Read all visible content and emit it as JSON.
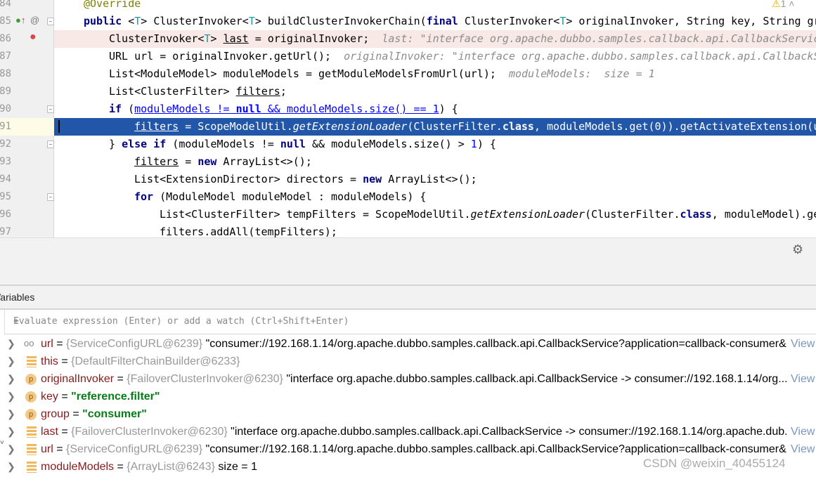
{
  "editor": {
    "warning_count": "1",
    "lines": [
      {
        "n": "84",
        "indent": 0,
        "tokens": [
          [
            "@Override",
            "ann"
          ]
        ]
      },
      {
        "n": "85",
        "indent": 0,
        "tokens": [
          [
            "public",
            "kw"
          ],
          [
            " <",
            ""
          ],
          [
            "T",
            "tp"
          ],
          [
            "> ClusterInvoker<",
            ""
          ],
          [
            "T",
            "tp"
          ],
          [
            "> buildClusterInvokerChain(",
            ""
          ],
          [
            "final",
            "kw"
          ],
          [
            " ClusterInvoker<",
            ""
          ],
          [
            "T",
            "tp"
          ],
          [
            "> originalInvoker, String key, String gr",
            ""
          ]
        ]
      },
      {
        "n": "86",
        "indent": 1,
        "state": "breakpoint",
        "tokens": [
          [
            "ClusterInvoker<",
            ""
          ],
          [
            "T",
            "tp"
          ],
          [
            "> ",
            ""
          ],
          [
            "last",
            "ul"
          ],
          [
            " = originalInvoker;  ",
            ""
          ],
          [
            "last: \"interface org.apache.dubbo.samples.callback.api.CallbackServic",
            "hint"
          ]
        ]
      },
      {
        "n": "87",
        "indent": 1,
        "tokens": [
          [
            "URL url = originalInvoker.getUrl();  ",
            ""
          ],
          [
            "originalInvoker: \"interface org.apache.dubbo.samples.callback.api.CallbackS",
            "hint"
          ]
        ]
      },
      {
        "n": "88",
        "indent": 1,
        "tokens": [
          [
            "List<ModuleModel> moduleModels = getModuleModelsFromUrl(url);  ",
            ""
          ],
          [
            "moduleModels:  size = 1",
            "hint"
          ]
        ]
      },
      {
        "n": "89",
        "indent": 1,
        "tokens": [
          [
            "List<ClusterFilter> ",
            ""
          ],
          [
            "filters",
            "ul"
          ],
          [
            ";",
            ""
          ]
        ]
      },
      {
        "n": "90",
        "indent": 1,
        "tokens": [
          [
            "if",
            "kw"
          ],
          [
            " (",
            ""
          ],
          [
            "moduleModels != ",
            "link"
          ],
          [
            "null",
            "link kw"
          ],
          [
            " && moduleModels.size() == ",
            "link"
          ],
          [
            "1",
            "link"
          ],
          [
            ") {",
            ""
          ]
        ]
      },
      {
        "n": "91",
        "indent": 2,
        "state": "current",
        "tokens": [
          [
            "filters",
            "ul"
          ],
          [
            " = ScopeModelUtil.",
            ""
          ],
          [
            "getExtensionLoader",
            "it"
          ],
          [
            "(ClusterFilter.",
            ""
          ],
          [
            "class",
            "kw"
          ],
          [
            ", moduleModels.get(0)).getActivateExtension(u",
            ""
          ]
        ]
      },
      {
        "n": "92",
        "indent": 1,
        "tokens": [
          [
            "} ",
            ""
          ],
          [
            "else if",
            "kw"
          ],
          [
            " (moduleModels != ",
            ""
          ],
          [
            "null",
            "kw"
          ],
          [
            " && moduleModels.size() > ",
            ""
          ],
          [
            "1",
            "num"
          ],
          [
            ") {",
            ""
          ]
        ]
      },
      {
        "n": "93",
        "indent": 2,
        "tokens": [
          [
            "filters",
            "ul"
          ],
          [
            " = ",
            ""
          ],
          [
            "new",
            "kw"
          ],
          [
            " ArrayList<>();",
            ""
          ]
        ]
      },
      {
        "n": "94",
        "indent": 2,
        "tokens": [
          [
            "List<ExtensionDirector> directors = ",
            ""
          ],
          [
            "new",
            "kw"
          ],
          [
            " ArrayList<>();",
            ""
          ]
        ]
      },
      {
        "n": "95",
        "indent": 2,
        "tokens": [
          [
            "for",
            "kw"
          ],
          [
            " (ModuleModel moduleModel : moduleModels) {",
            ""
          ]
        ]
      },
      {
        "n": "96",
        "indent": 3,
        "tokens": [
          [
            "List<ClusterFilter> tempFilters = ScopeModelUtil.",
            ""
          ],
          [
            "getExtensionLoader",
            "it"
          ],
          [
            "(ClusterFilter.",
            ""
          ],
          [
            "class",
            "kw"
          ],
          [
            ", moduleModel).ge",
            ""
          ]
        ]
      },
      {
        "n": "97",
        "indent": 3,
        "tokens": [
          [
            "filters.addAll(tempFilters);",
            ""
          ]
        ]
      }
    ]
  },
  "variables": {
    "tab_label": "Variables",
    "eval_placeholder": "Evaluate expression (Enter) or add a watch (Ctrl+Shift+Enter)",
    "view_label": "View",
    "rows": [
      {
        "icon": "watch",
        "name": "url",
        "type": "{ServiceConfigURL@6239}",
        "value": "\"consumer://192.168.1.14/org.apache.dubbo.samples.callback.api.CallbackService?application=callback-consumer&...",
        "view": true
      },
      {
        "icon": "field",
        "name": "this",
        "type": "{DefaultFilterChainBuilder@6233}",
        "value": ""
      },
      {
        "icon": "param",
        "name": "originalInvoker",
        "type": "{FailoverClusterInvoker@6230}",
        "value": "\"interface org.apache.dubbo.samples.callback.api.CallbackService -> consumer://192.168.1.14/org....",
        "view": true
      },
      {
        "icon": "param",
        "name": "key",
        "type": "",
        "value": "\"reference.filter\"",
        "str": true
      },
      {
        "icon": "param",
        "name": "group",
        "type": "",
        "value": "\"consumer\"",
        "str": true
      },
      {
        "icon": "field",
        "name": "last",
        "type": "{FailoverClusterInvoker@6230}",
        "value": "\"interface org.apache.dubbo.samples.callback.api.CallbackService -> consumer://192.168.1.14/org.apache.dub...",
        "view": true
      },
      {
        "icon": "field",
        "name": "url",
        "type": "{ServiceConfigURL@6239}",
        "value": "\"consumer://192.168.1.14/org.apache.dubbo.samples.callback.api.CallbackService?application=callback-consumer&...",
        "view": true
      },
      {
        "icon": "field",
        "name": "moduleModels",
        "type": "{ArrayList@6243}",
        "value": " size = 1"
      }
    ]
  },
  "watermark": "CSDN @weixin_40455124"
}
